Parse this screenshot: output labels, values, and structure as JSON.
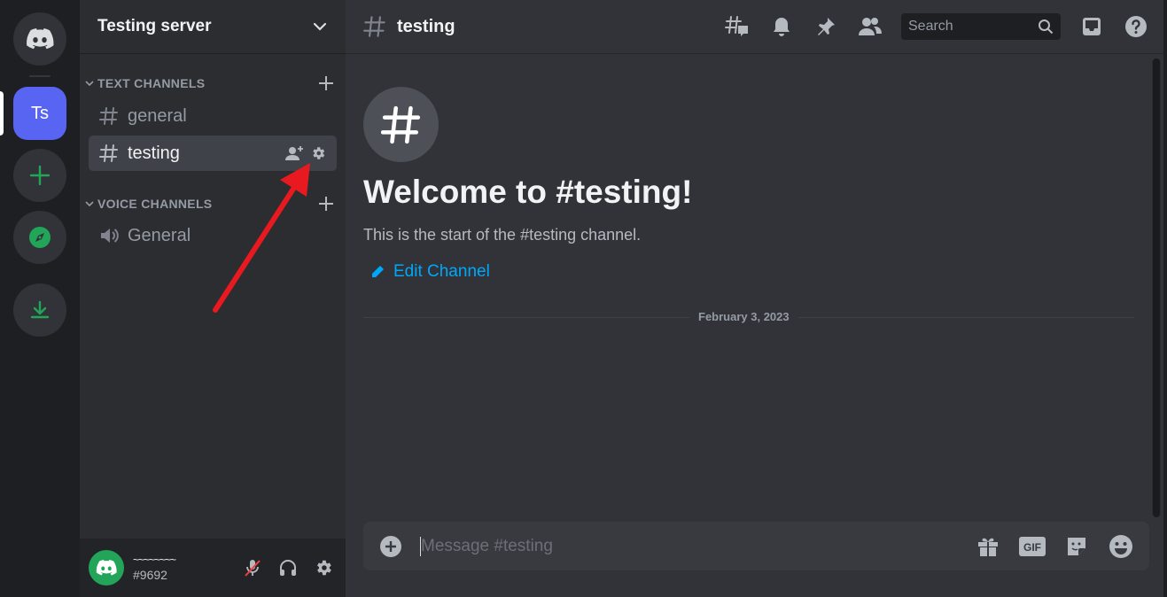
{
  "rail": {
    "active_server_initials": "Ts"
  },
  "sidebar": {
    "server_name": "Testing server",
    "categories": [
      {
        "label": "TEXT CHANNELS"
      },
      {
        "label": "VOICE CHANNELS"
      }
    ],
    "channels": [
      {
        "name": "general",
        "type": "text"
      },
      {
        "name": "testing",
        "type": "text",
        "selected": true
      },
      {
        "name": "General",
        "type": "voice"
      }
    ]
  },
  "user": {
    "name": "~~~~~~~~",
    "tag": "#9692"
  },
  "header": {
    "channel_name": "testing",
    "search_placeholder": "Search"
  },
  "welcome": {
    "title": "Welcome to #testing!",
    "subtitle": "This is the start of the #testing channel.",
    "edit_label": "Edit Channel"
  },
  "divider_date": "February 3, 2023",
  "composer": {
    "placeholder": "Message #testing"
  },
  "colors": {
    "accent": "#5865f2",
    "green": "#23a559",
    "link": "#00a8fc",
    "annotation_arrow": "#e8191f"
  },
  "icons": [
    "discord-logo-icon",
    "plus-icon",
    "compass-icon",
    "download-icon",
    "chevron-down-icon",
    "hash-icon",
    "speaker-icon",
    "add-member-icon",
    "gear-icon",
    "threads-icon",
    "bell-icon",
    "pin-icon",
    "members-icon",
    "search-icon",
    "inbox-icon",
    "help-icon",
    "pencil-icon",
    "gift-icon",
    "gif-icon",
    "sticker-icon",
    "emoji-icon",
    "mic-muted-icon",
    "headphones-icon"
  ]
}
